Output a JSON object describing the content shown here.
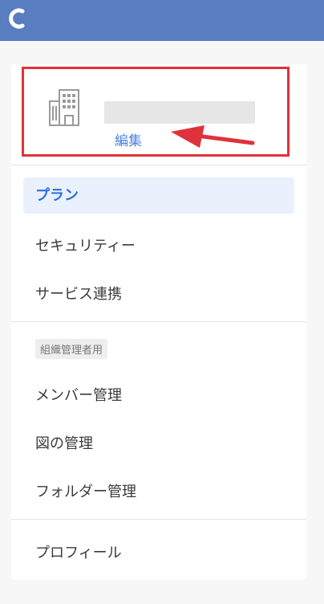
{
  "header": {
    "logo_icon": "crescent-logo-icon",
    "bar_color": "#587dc0"
  },
  "org": {
    "icon": "building-icon",
    "edit_label": "編集",
    "highlight_color": "#e0323c"
  },
  "menu": {
    "plan": "プラン",
    "security": "セキュリティー",
    "services": "サービス連携",
    "admin_section": "組織管理者用",
    "members": "メンバー管理",
    "diagrams": "図の管理",
    "folders": "フォルダー管理",
    "profile": "プロフィール"
  },
  "colors": {
    "accent": "#2f6fdc",
    "active_bg": "#eaf1fd"
  }
}
